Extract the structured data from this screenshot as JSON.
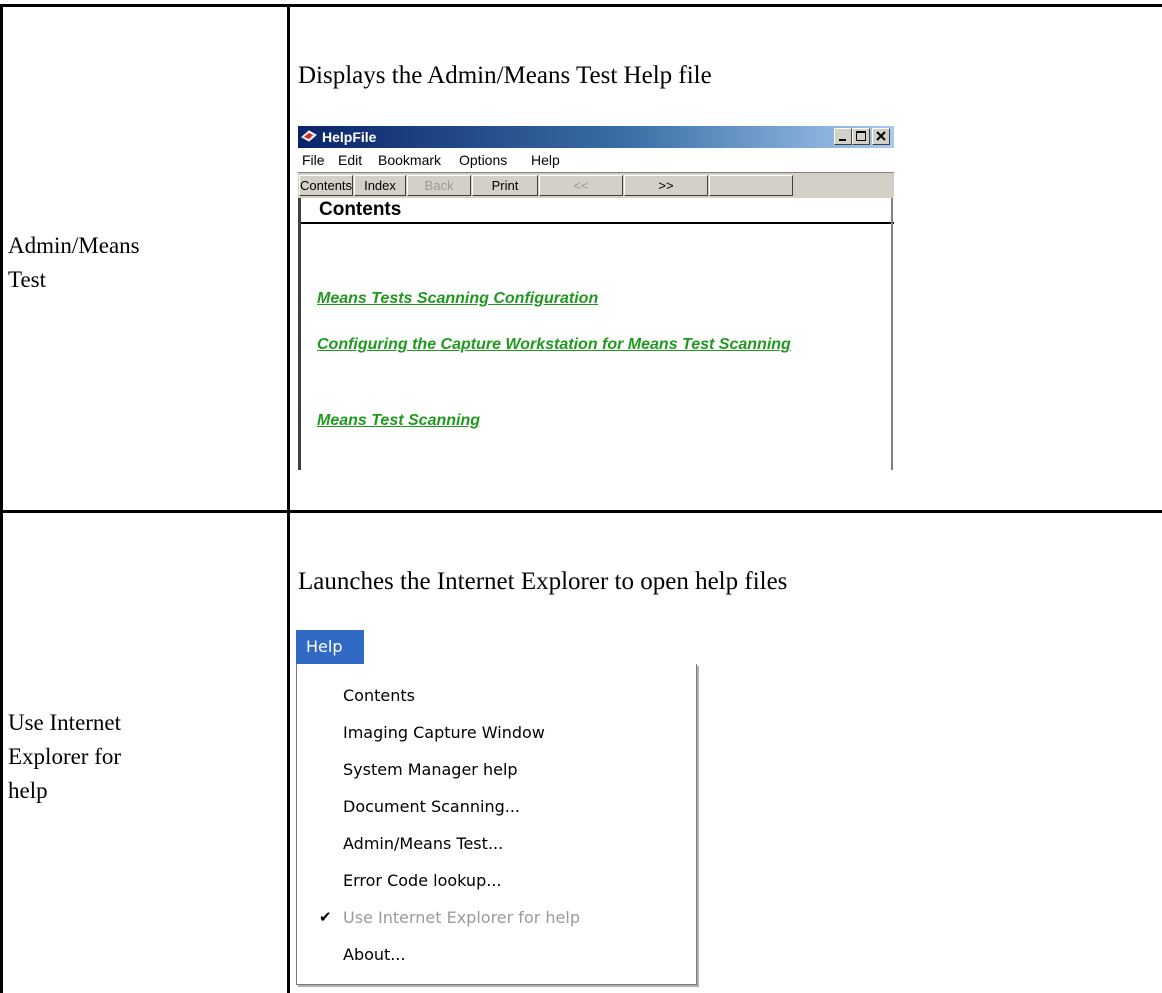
{
  "rows": [
    {
      "label_lines": [
        "Admin/Means",
        "Test"
      ],
      "description": "Displays the Admin/Means Test Help file"
    },
    {
      "label_lines": [
        "Use Internet",
        "Explorer for",
        "help"
      ],
      "description": "Launches the Internet Explorer to open help files"
    }
  ],
  "helpfile": {
    "title": "HelpFile",
    "menu": [
      "File",
      "Edit",
      "Bookmark",
      "Options",
      "Help"
    ],
    "toolbar": [
      {
        "label": "Contents",
        "enabled": true
      },
      {
        "label": "Index",
        "enabled": true
      },
      {
        "label": "Back",
        "enabled": false
      },
      {
        "label": "Print",
        "enabled": true
      },
      {
        "label": "<<",
        "enabled": false
      },
      {
        "label": ">>",
        "enabled": true
      }
    ],
    "heading": "Contents",
    "links": [
      "Means Tests Scanning Configuration",
      "Configuring the Capture Workstation for Means Test Scanning",
      "Means Test Scanning"
    ],
    "link_color": "#1f9a1f"
  },
  "help_menu": {
    "title": "Help",
    "highlight_color": "#316ac5",
    "items": [
      {
        "label": "Contents",
        "disabled": false,
        "checked": false
      },
      {
        "label": "Imaging Capture Window",
        "disabled": false,
        "checked": false
      },
      {
        "label": "System Manager help",
        "disabled": false,
        "checked": false
      },
      {
        "label": "Document Scanning...",
        "disabled": false,
        "checked": false
      },
      {
        "label": "Admin/Means Test...",
        "disabled": false,
        "checked": false
      },
      {
        "label": "Error Code lookup...",
        "disabled": false,
        "checked": false
      },
      {
        "label": "Use Internet Explorer for help",
        "disabled": true,
        "checked": true
      },
      {
        "label": "About...",
        "disabled": false,
        "checked": false
      }
    ]
  }
}
